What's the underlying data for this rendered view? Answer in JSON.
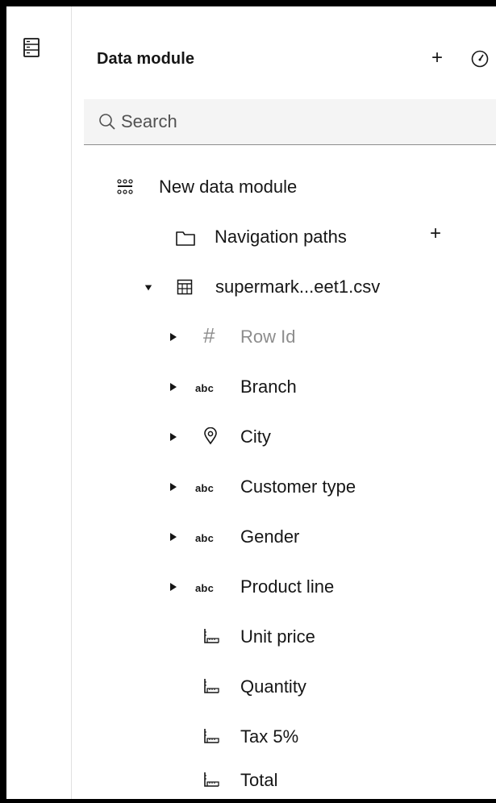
{
  "panel": {
    "title": "Data module",
    "add_label": "+"
  },
  "search": {
    "placeholder": "Search"
  },
  "tree": {
    "module_label": "New data module",
    "nav_paths_label": "Navigation paths",
    "nav_paths_add": "+",
    "table_label": "supermark...eet1.csv",
    "fields": [
      {
        "label": "Row Id",
        "type": "number-id",
        "muted": true,
        "expandable": true
      },
      {
        "label": "Branch",
        "type": "text",
        "type_label": "abc",
        "expandable": true
      },
      {
        "label": "City",
        "type": "location",
        "expandable": true
      },
      {
        "label": "Customer type",
        "type": "text",
        "type_label": "abc",
        "expandable": true
      },
      {
        "label": "Gender",
        "type": "text",
        "type_label": "abc",
        "expandable": true
      },
      {
        "label": "Product line",
        "type": "text",
        "type_label": "abc",
        "expandable": true
      },
      {
        "label": "Unit price",
        "type": "measure",
        "expandable": false
      },
      {
        "label": "Quantity",
        "type": "measure",
        "expandable": false
      },
      {
        "label": "Tax 5%",
        "type": "measure",
        "expandable": false
      },
      {
        "label": "Total",
        "type": "measure",
        "expandable": false
      }
    ],
    "hash_symbol": "#"
  },
  "icons": {
    "rail": "data-module-icon",
    "speed": "gauge-icon",
    "search": "search-icon",
    "module": "data-module-tree-icon",
    "folder": "folder-icon",
    "table": "table-icon",
    "location": "location-pin-icon",
    "measure": "measure-ruler-icon"
  },
  "colors": {
    "text": "#161616",
    "muted": "#8d8d8d",
    "search_bg": "#f4f4f4"
  }
}
